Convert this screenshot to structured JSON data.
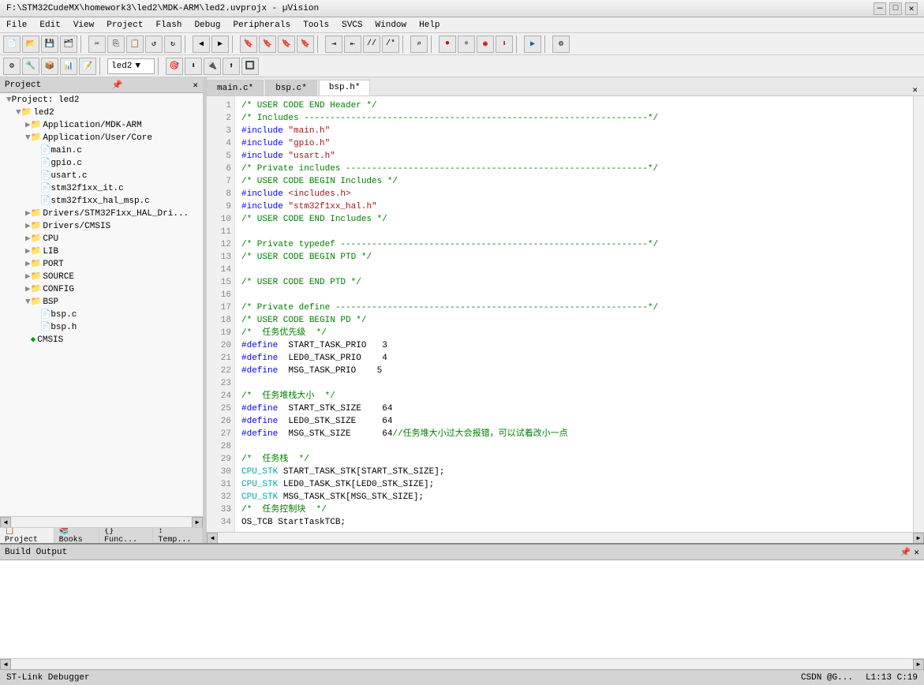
{
  "titlebar": {
    "title": "F:\\STM32CudeMX\\homework3\\led2\\MDK-ARM\\led2.uvprojx - µVision",
    "controls": [
      "—",
      "□",
      "✕"
    ]
  },
  "menubar": {
    "items": [
      "File",
      "Edit",
      "View",
      "Project",
      "Flash",
      "Debug",
      "Peripherals",
      "Tools",
      "SVCS",
      "Window",
      "Help"
    ]
  },
  "toolbar2": {
    "dropdown_value": "led2"
  },
  "project": {
    "title": "Project",
    "tree": [
      {
        "level": 1,
        "type": "root",
        "label": "Project: led2",
        "icon": "project"
      },
      {
        "level": 2,
        "type": "folder",
        "label": "led2",
        "icon": "folder"
      },
      {
        "level": 3,
        "type": "folder",
        "label": "Application/MDK-ARM",
        "icon": "folder"
      },
      {
        "level": 3,
        "type": "folder",
        "label": "Application/User/Core",
        "icon": "folder"
      },
      {
        "level": 4,
        "type": "file",
        "label": "main.c",
        "icon": "file"
      },
      {
        "level": 4,
        "type": "file",
        "label": "gpio.c",
        "icon": "file"
      },
      {
        "level": 4,
        "type": "file",
        "label": "usart.c",
        "icon": "file"
      },
      {
        "level": 4,
        "type": "file",
        "label": "stm32f1xx_it.c",
        "icon": "file"
      },
      {
        "level": 4,
        "type": "file",
        "label": "stm32f1xx_hal_msp.c",
        "icon": "file"
      },
      {
        "level": 3,
        "type": "folder",
        "label": "Drivers/STM32F1xx_HAL_Driv...",
        "icon": "folder"
      },
      {
        "level": 3,
        "type": "folder",
        "label": "Drivers/CMSIS",
        "icon": "folder"
      },
      {
        "level": 3,
        "type": "folder",
        "label": "CPU",
        "icon": "folder"
      },
      {
        "level": 3,
        "type": "folder",
        "label": "LIB",
        "icon": "folder"
      },
      {
        "level": 3,
        "type": "folder",
        "label": "PORT",
        "icon": "folder"
      },
      {
        "level": 3,
        "type": "folder",
        "label": "SOURCE",
        "icon": "folder"
      },
      {
        "level": 3,
        "type": "folder",
        "label": "CONFIG",
        "icon": "folder"
      },
      {
        "level": 3,
        "type": "folder",
        "label": "BSP",
        "icon": "folder"
      },
      {
        "level": 4,
        "type": "file",
        "label": "bsp.c",
        "icon": "file"
      },
      {
        "level": 4,
        "type": "file",
        "label": "bsp.h",
        "icon": "file"
      },
      {
        "level": 3,
        "type": "special",
        "label": "CMSIS",
        "icon": "diamond"
      }
    ],
    "tabs": [
      {
        "label": "Project",
        "active": true
      },
      {
        "label": "Books",
        "active": false
      },
      {
        "label": "{} Func...",
        "active": false
      },
      {
        "label": "↑↓ Temp...",
        "active": false
      }
    ]
  },
  "editor": {
    "tabs": [
      {
        "label": "main.c*",
        "active": false
      },
      {
        "label": "bsp.c*",
        "active": false
      },
      {
        "label": "bsp.h*",
        "active": true
      }
    ],
    "lines": [
      {
        "num": 1,
        "code": "  <c-comment>/* USER CODE END Header */</c-comment>"
      },
      {
        "num": 2,
        "code": "  <c-comment>/* Includes ------------------------------------------------------------------*/</c-comment>"
      },
      {
        "num": 3,
        "code": "  <c-preproc>#include</c-preproc> <c-string>\"main.h\"</c-string>"
      },
      {
        "num": 4,
        "code": "  <c-preproc>#include</c-preproc> <c-string>\"gpio.h\"</c-string>"
      },
      {
        "num": 5,
        "code": "  <c-preproc>#include</c-preproc> <c-string>\"usart.h\"</c-string>"
      },
      {
        "num": 6,
        "code": "  <c-comment>/* Private includes ----------------------------------------------------------*/</c-comment>"
      },
      {
        "num": 7,
        "code": "  <c-comment>/* USER CODE BEGIN Includes */</c-comment>"
      },
      {
        "num": 8,
        "code": "  <c-preproc>#include</c-preproc> <c-string>&lt;includes.h&gt;</c-string>"
      },
      {
        "num": 9,
        "code": "  <c-preproc>#include</c-preproc> <c-string>\"stm32f1xx_hal.h\"</c-string>"
      },
      {
        "num": 10,
        "code": "  <c-comment>/* USER CODE END Includes */</c-comment>"
      },
      {
        "num": 11,
        "code": ""
      },
      {
        "num": 12,
        "code": "  <c-comment>/* Private typedef -----------------------------------------------------------*/</c-comment>"
      },
      {
        "num": 13,
        "code": "  <c-comment>/* USER CODE BEGIN PTD */</c-comment>"
      },
      {
        "num": 14,
        "code": ""
      },
      {
        "num": 15,
        "code": "  <c-comment>/* USER CODE END PTD */</c-comment>"
      },
      {
        "num": 16,
        "code": ""
      },
      {
        "num": 17,
        "code": "  <c-comment>/* Private define ------------------------------------------------------------*/</c-comment>"
      },
      {
        "num": 18,
        "code": "  <c-comment>/* USER CODE BEGIN PD */</c-comment>"
      },
      {
        "num": 19,
        "code": "  <c-comment>/*  任务优先级  */</c-comment>"
      },
      {
        "num": 20,
        "code": "  <c-preproc>#define</c-preproc>  START_TASK_PRIO   3"
      },
      {
        "num": 21,
        "code": "  <c-preproc>#define</c-preproc>  LED0_TASK_PRIO    4"
      },
      {
        "num": 22,
        "code": "  <c-preproc>#define</c-preproc>  MSG_TASK_PRIO    5"
      },
      {
        "num": 23,
        "code": ""
      },
      {
        "num": 24,
        "code": "  <c-comment>/*  任务堆栈大小  */</c-comment>"
      },
      {
        "num": 25,
        "code": "  <c-preproc>#define</c-preproc>  START_STK_SIZE    64"
      },
      {
        "num": 26,
        "code": "  <c-preproc>#define</c-preproc>  LED0_STK_SIZE     64"
      },
      {
        "num": 27,
        "code": "  <c-preproc>#define</c-preproc>  MSG_STK_SIZE      64<c-comment>//任务堆大小过大会报错，可以试着改小一点</c-comment>"
      },
      {
        "num": 28,
        "code": ""
      },
      {
        "num": 29,
        "code": "  <c-comment>/*  任务栈  */</c-comment>"
      },
      {
        "num": 30,
        "code": "  <c-cyan>CPU_STK</c-cyan> START_TASK_STK[START_STK_SIZE];"
      },
      {
        "num": 31,
        "code": "  <c-cyan>CPU_STK</c-cyan> LED0_TASK_STK[LED0_STK_SIZE];"
      },
      {
        "num": 32,
        "code": "  <c-cyan>CPU_STK</c-cyan> MSG_TASK_STK[MSG_STK_SIZE];"
      },
      {
        "num": 33,
        "code": "  <c-comment>/*  任务控制块  */</c-comment>"
      },
      {
        "num": 34,
        "code": "  OS_TCB StartTaskTCB;"
      }
    ]
  },
  "build_output": {
    "title": "Build Output",
    "content": ""
  },
  "statusbar": {
    "left": "ST-Link Debugger",
    "right": "CSDN @G...",
    "position": "L1:13 C:19"
  }
}
